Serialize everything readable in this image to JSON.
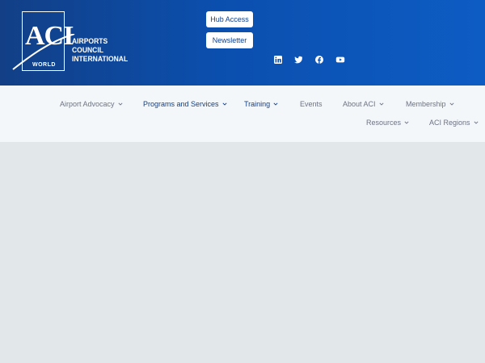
{
  "brand": {
    "logo_letters": "ACI",
    "logo_world": "WORLD",
    "name_lines": [
      "AIRPORTS",
      "COUNCIL",
      "INTERNATIONAL"
    ]
  },
  "header_buttons": {
    "hub_access": "Hub Access",
    "newsletter": "Newsletter"
  },
  "social_icons": [
    "linkedin-icon",
    "twitter-icon",
    "facebook-icon",
    "youtube-icon"
  ],
  "nav": {
    "items": [
      {
        "label": "Airport Advocacy",
        "dropdown": true
      },
      {
        "label": "Programs and Services",
        "dropdown": true
      },
      {
        "label": "Training",
        "dropdown": true
      },
      {
        "label": "Events",
        "dropdown": false
      },
      {
        "label": "About ACI",
        "dropdown": true
      },
      {
        "label": "Membership",
        "dropdown": true
      },
      {
        "label": "Resources",
        "dropdown": true
      },
      {
        "label": "ACI Regions",
        "dropdown": true
      }
    ]
  },
  "colors": {
    "header_start": "#123f86",
    "header_end": "#0d5cc4",
    "nav_bg": "#f4f7fa",
    "nav_text": "#6c7383",
    "nav_text_active": "#123f86",
    "content_bg": "#e2e8ea"
  }
}
